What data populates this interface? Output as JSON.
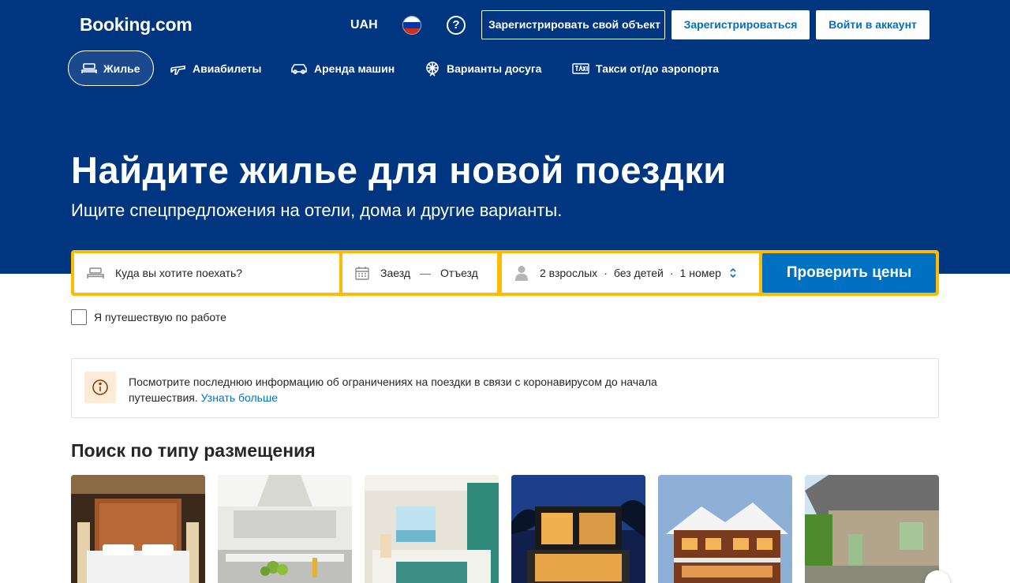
{
  "header": {
    "logo": "Booking.com",
    "currency": "UAH",
    "help_symbol": "?",
    "list_property": "Зарегистрировать свой объект",
    "register": "Зарегистрироваться",
    "login": "Войти в аккаунт"
  },
  "nav": [
    {
      "label": "Жилье",
      "icon": "bed-icon",
      "active": true
    },
    {
      "label": "Авиабилеты",
      "icon": "plane-icon"
    },
    {
      "label": "Аренда машин",
      "icon": "car-icon"
    },
    {
      "label": "Варианты досуга",
      "icon": "attractions-icon"
    },
    {
      "label": "Такси от/до аэропорта",
      "icon": "taxi-icon"
    }
  ],
  "hero": {
    "title": "Найдите жилье для новой поездки",
    "subtitle": "Ищите спецпредложения на отели, дома и другие варианты."
  },
  "search": {
    "destination_placeholder": "Куда вы хотите поехать?",
    "checkin": "Заезд",
    "date_separator": "—",
    "checkout": "Отъезд",
    "adults": "2 взрослых",
    "children": "без детей",
    "rooms": "1 номер",
    "dot": "·",
    "submit": "Проверить цены"
  },
  "business_trip": "Я путешествую по работе",
  "alert": {
    "text": "Посмотрите последнюю информацию об ограничениях на поездки в связи с коронавирусом до начала путешествия.",
    "link": "Узнать больше"
  },
  "property_types": {
    "title": "Поиск по типу размещения"
  },
  "colors": {
    "brand": "#003580",
    "accent": "#0071c2",
    "search_border": "#febb02"
  }
}
